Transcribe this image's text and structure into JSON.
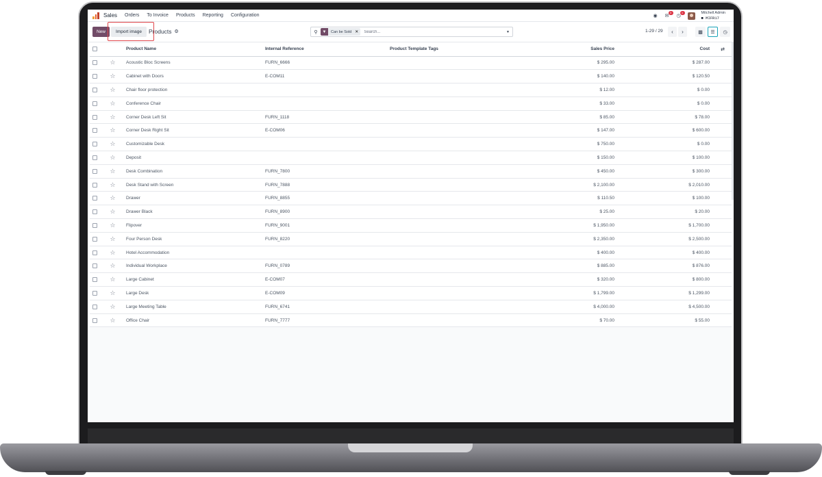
{
  "app": {
    "name": "Sales",
    "menu": [
      "Orders",
      "To Invoice",
      "Products",
      "Reporting",
      "Configuration"
    ],
    "notifications": {
      "messages": "3",
      "activities": "1"
    },
    "user": {
      "name": "Mitchell Admin",
      "database": "MIFR17"
    }
  },
  "controlbar": {
    "new_label": "New",
    "import_label": "Import image",
    "breadcrumb": "Products"
  },
  "search": {
    "facet_label": "Can be Sold",
    "placeholder": "Search..."
  },
  "pager": {
    "range": "1-29 / 29"
  },
  "table": {
    "columns": {
      "name": "Product Name",
      "ref": "Internal Reference",
      "tags": "Product Template Tags",
      "price": "Sales Price",
      "cost": "Cost"
    },
    "rows": [
      {
        "name": "Acoustic Bloc Screens",
        "ref": "FURN_6666",
        "tags": "",
        "price": "$ 295.00",
        "cost": "$ 287.00"
      },
      {
        "name": "Cabinet with Doors",
        "ref": "E-COM11",
        "tags": "",
        "price": "$ 140.00",
        "cost": "$ 120.50"
      },
      {
        "name": "Chair floor protection",
        "ref": "",
        "tags": "",
        "price": "$ 12.00",
        "cost": "$ 0.00"
      },
      {
        "name": "Conference Chair",
        "ref": "",
        "tags": "",
        "price": "$ 33.00",
        "cost": "$ 0.00"
      },
      {
        "name": "Corner Desk Left Sit",
        "ref": "FURN_1118",
        "tags": "",
        "price": "$ 85.00",
        "cost": "$ 78.00"
      },
      {
        "name": "Corner Desk Right Sit",
        "ref": "E-COM06",
        "tags": "",
        "price": "$ 147.00",
        "cost": "$ 600.00"
      },
      {
        "name": "Customizable Desk",
        "ref": "",
        "tags": "",
        "price": "$ 750.00",
        "cost": "$ 0.00"
      },
      {
        "name": "Deposit",
        "ref": "",
        "tags": "",
        "price": "$ 150.00",
        "cost": "$ 100.00"
      },
      {
        "name": "Desk Combination",
        "ref": "FURN_7800",
        "tags": "",
        "price": "$ 450.00",
        "cost": "$ 300.00"
      },
      {
        "name": "Desk Stand with Screen",
        "ref": "FURN_7888",
        "tags": "",
        "price": "$ 2,100.00",
        "cost": "$ 2,010.00"
      },
      {
        "name": "Drawer",
        "ref": "FURN_8855",
        "tags": "",
        "price": "$ 110.50",
        "cost": "$ 100.00"
      },
      {
        "name": "Drawer Black",
        "ref": "FURN_8900",
        "tags": "",
        "price": "$ 25.00",
        "cost": "$ 20.00"
      },
      {
        "name": "Flipover",
        "ref": "FURN_9001",
        "tags": "",
        "price": "$ 1,950.00",
        "cost": "$ 1,700.00"
      },
      {
        "name": "Four Person Desk",
        "ref": "FURN_8220",
        "tags": "",
        "price": "$ 2,350.00",
        "cost": "$ 2,500.00"
      },
      {
        "name": "Hotel Accommodation",
        "ref": "",
        "tags": "",
        "price": "$ 400.00",
        "cost": "$ 400.00"
      },
      {
        "name": "Individual Workplace",
        "ref": "FURN_0789",
        "tags": "",
        "price": "$ 885.00",
        "cost": "$ 876.00"
      },
      {
        "name": "Large Cabinet",
        "ref": "E-COM07",
        "tags": "",
        "price": "$ 320.00",
        "cost": "$ 800.00"
      },
      {
        "name": "Large Desk",
        "ref": "E-COM09",
        "tags": "",
        "price": "$ 1,799.00",
        "cost": "$ 1,299.00"
      },
      {
        "name": "Large Meeting Table",
        "ref": "FURN_6741",
        "tags": "",
        "price": "$ 4,000.00",
        "cost": "$ 4,500.00"
      },
      {
        "name": "Office Chair",
        "ref": "FURN_7777",
        "tags": "",
        "price": "$ 70.00",
        "cost": "$ 55.00"
      }
    ]
  },
  "colors": {
    "brand": "#714b67",
    "highlight": "#e0454a",
    "active_view": "#17a2b8"
  }
}
